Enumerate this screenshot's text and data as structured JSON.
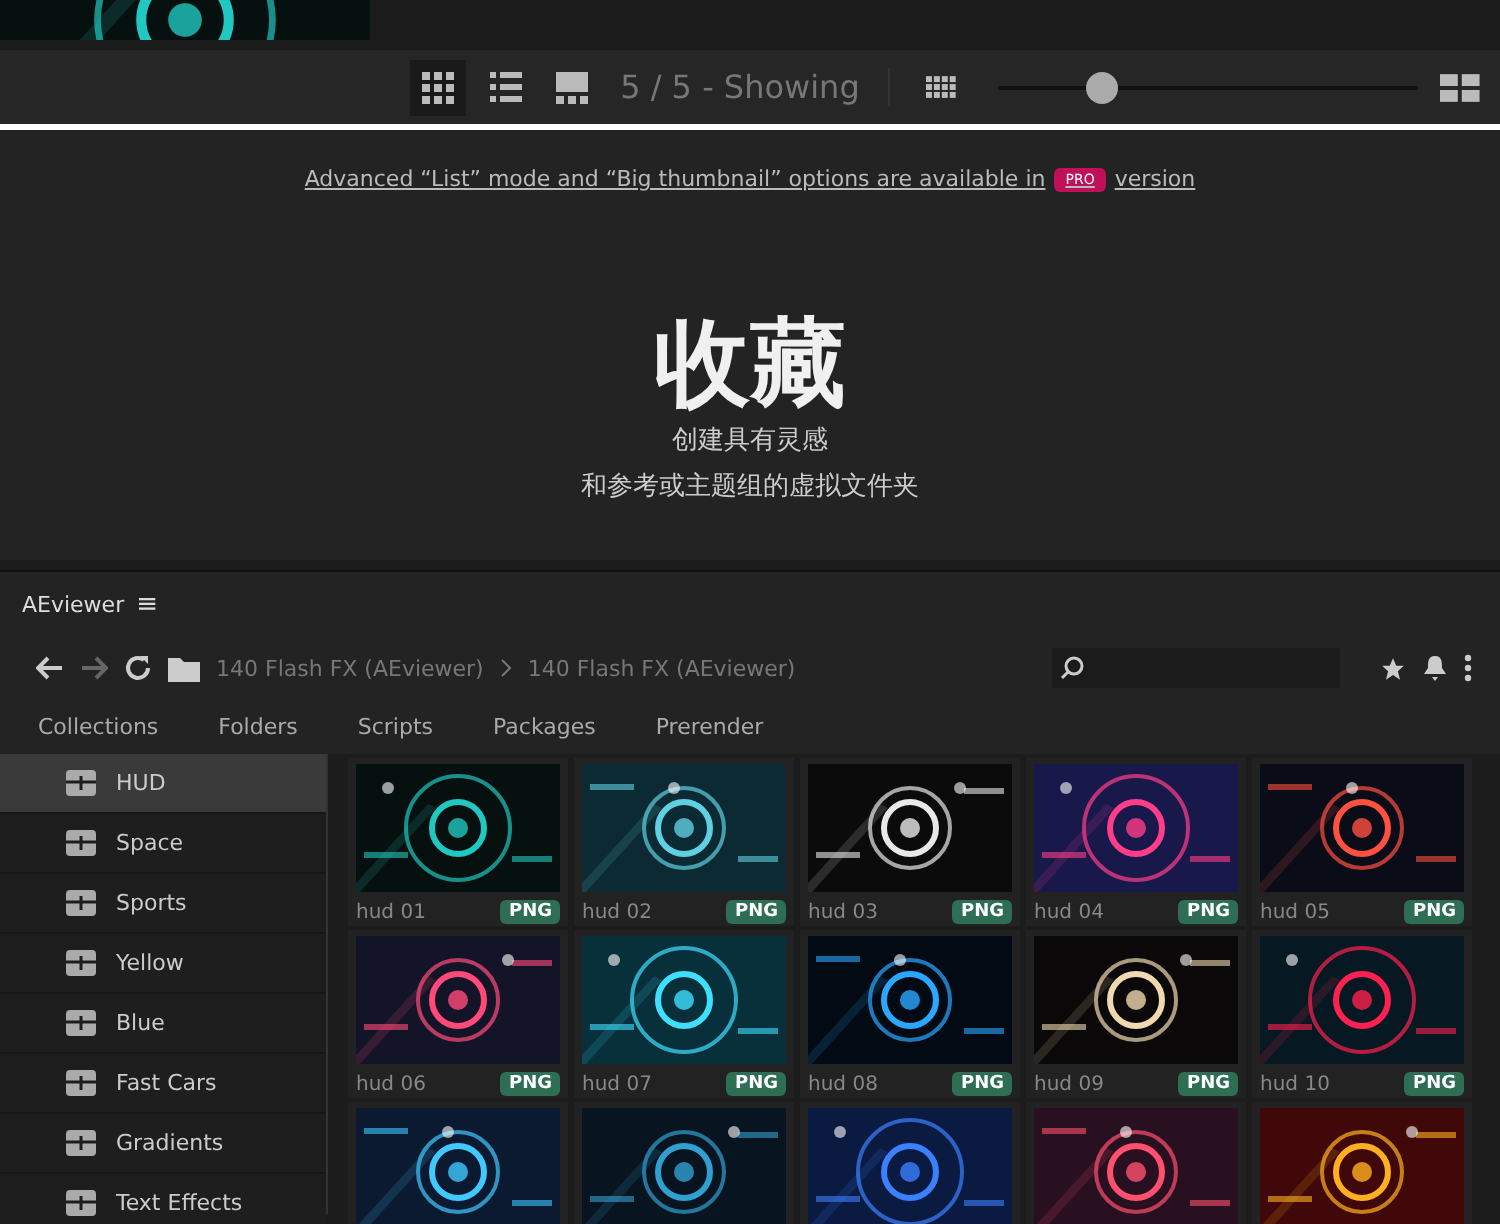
{
  "toolbar": {
    "views": [
      {
        "kind": "grid",
        "selected": true
      },
      {
        "kind": "list",
        "selected": false
      },
      {
        "kind": "big",
        "selected": false
      }
    ],
    "count": "5 / 5 - Showing",
    "size_slider": {
      "level": 0.25
    }
  },
  "promo": {
    "text_before": "Advanced “List” mode and “Big thumbnail” options are available in",
    "badge": "PRO",
    "text_after": "version"
  },
  "collections": {
    "title": "收藏",
    "lines": [
      "创建具有灵感",
      "和参考或主题组的虚拟文件夹"
    ]
  },
  "panel": {
    "title": "AEviewer",
    "menu": "≡"
  },
  "breadcrumb": [
    "140 Flash FX (AEviewer)",
    "140 Flash FX (AEviewer)"
  ],
  "tabs": [
    {
      "label": "Collections",
      "selected": false
    },
    {
      "label": "Folders",
      "selected": false
    },
    {
      "label": "Scripts",
      "selected": false
    },
    {
      "label": "Packages",
      "selected": false
    },
    {
      "label": "Prerender",
      "selected": false
    }
  ],
  "sidebar": {
    "items": [
      {
        "label": "HUD",
        "selected": true
      },
      {
        "label": "Space",
        "selected": false
      },
      {
        "label": "Sports",
        "selected": false
      },
      {
        "label": "Yellow",
        "selected": false
      },
      {
        "label": "Blue",
        "selected": false
      },
      {
        "label": "Fast Cars",
        "selected": false
      },
      {
        "label": "Gradients",
        "selected": false
      },
      {
        "label": "Text Effects",
        "selected": false
      }
    ]
  },
  "items": [
    {
      "name": "hud 01",
      "format": "PNG"
    },
    {
      "name": "hud 02",
      "format": "PNG"
    },
    {
      "name": "hud 03",
      "format": "PNG"
    },
    {
      "name": "hud 04",
      "format": "PNG"
    },
    {
      "name": "hud 05",
      "format": "PNG"
    },
    {
      "name": "hud 06",
      "format": "PNG"
    },
    {
      "name": "hud 07",
      "format": "PNG"
    },
    {
      "name": "hud 08",
      "format": "PNG"
    },
    {
      "name": "hud 09",
      "format": "PNG"
    },
    {
      "name": "hud 10",
      "format": "PNG"
    },
    {
      "kind": "picture"
    },
    {
      "kind": "picture"
    },
    {
      "kind": "picture"
    },
    {
      "kind": "picture"
    },
    {
      "kind": "picture"
    }
  ]
}
